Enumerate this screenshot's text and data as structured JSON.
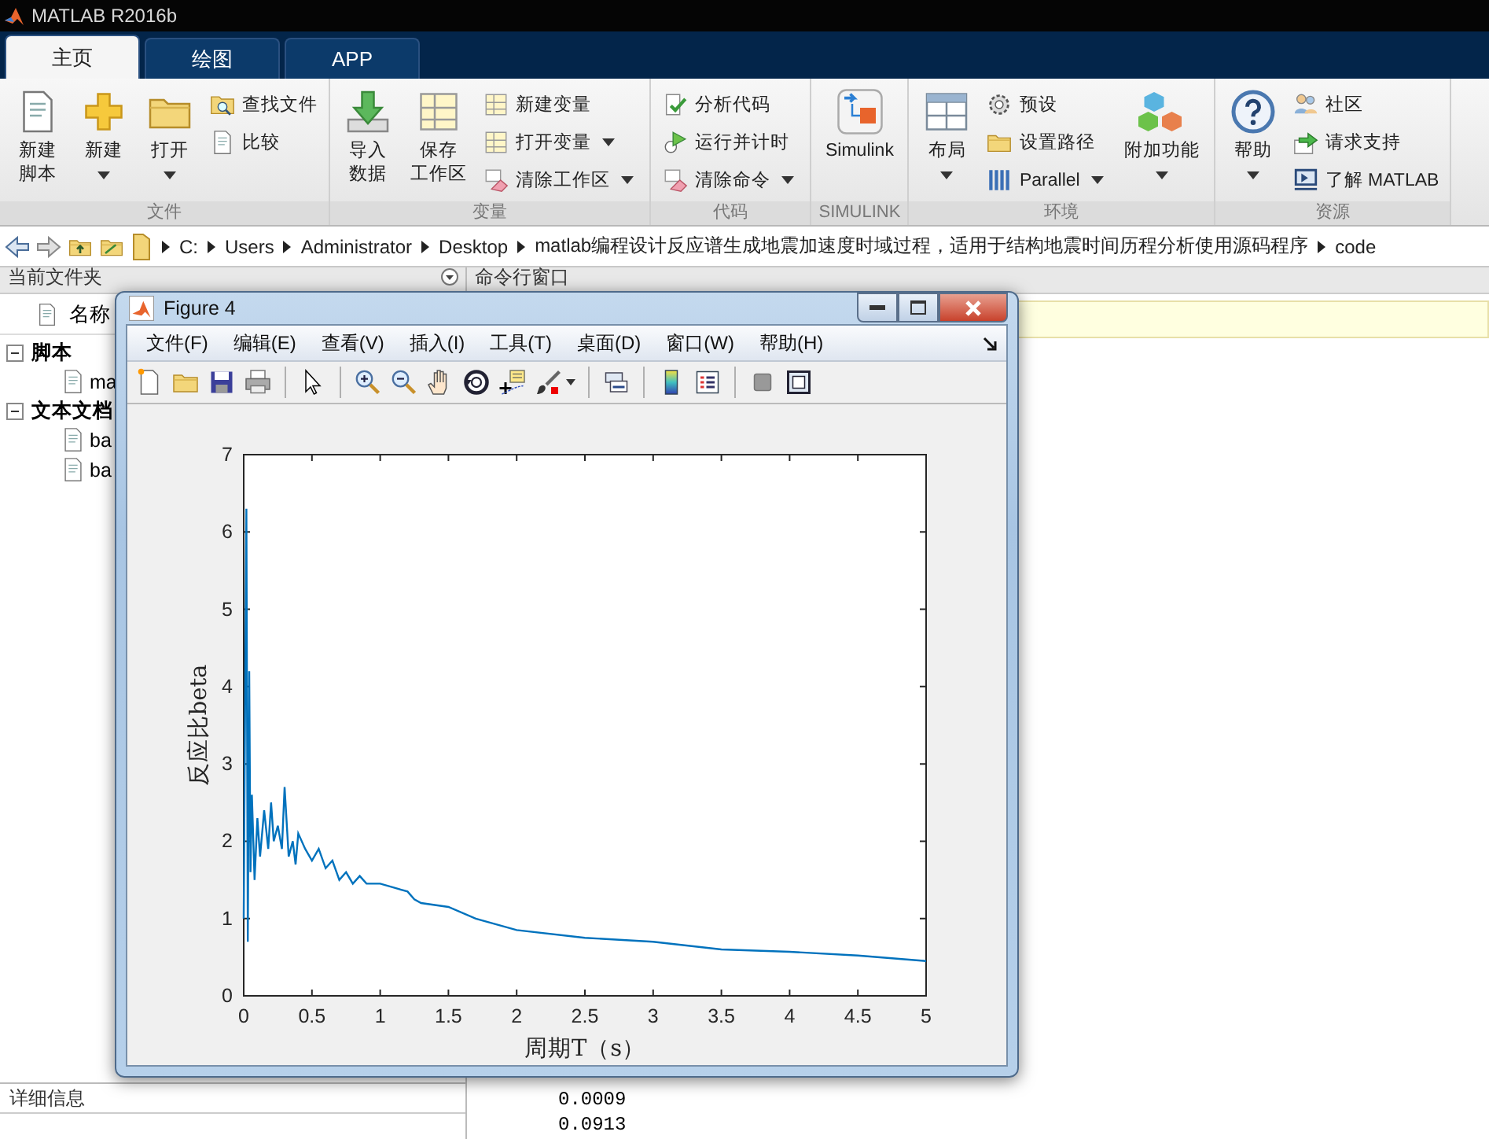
{
  "window": {
    "title": "MATLAB R2016b"
  },
  "tabs": [
    {
      "label": "主页",
      "selected": true
    },
    {
      "label": "绘图",
      "selected": false
    },
    {
      "label": "APP",
      "selected": false
    }
  ],
  "ribbon": {
    "groups": [
      {
        "label": "文件",
        "items": [
          {
            "kind": "large",
            "lines": [
              "新建",
              "脚本"
            ],
            "dropdown": false
          },
          {
            "kind": "large",
            "lines": [
              "新建"
            ],
            "dropdown": true
          },
          {
            "kind": "large",
            "lines": [
              "打开"
            ],
            "dropdown": true
          },
          {
            "kind": "stack",
            "items": [
              {
                "label": "查找文件",
                "dropdown": false
              },
              {
                "label": "比较",
                "dropdown": false
              }
            ]
          }
        ]
      },
      {
        "label": "变量",
        "items": [
          {
            "kind": "large",
            "lines": [
              "导入",
              "数据"
            ],
            "dropdown": false
          },
          {
            "kind": "large",
            "lines": [
              "保存",
              "工作区"
            ],
            "dropdown": false
          },
          {
            "kind": "stack",
            "items": [
              {
                "label": "新建变量",
                "dropdown": false
              },
              {
                "label": "打开变量",
                "dropdown": true
              },
              {
                "label": "清除工作区",
                "dropdown": true
              }
            ]
          }
        ]
      },
      {
        "label": "代码",
        "items": [
          {
            "kind": "stack",
            "items": [
              {
                "label": "分析代码",
                "dropdown": false
              },
              {
                "label": "运行并计时",
                "dropdown": false
              },
              {
                "label": "清除命令",
                "dropdown": true
              }
            ]
          }
        ]
      },
      {
        "label": "SIMULINK",
        "items": [
          {
            "kind": "large",
            "lines": [
              "Simulink"
            ],
            "dropdown": false
          }
        ]
      },
      {
        "label": "环境",
        "items": [
          {
            "kind": "large",
            "lines": [
              "布局"
            ],
            "dropdown": true
          },
          {
            "kind": "stack",
            "items": [
              {
                "label": "预设",
                "dropdown": false
              },
              {
                "label": "设置路径",
                "dropdown": false
              },
              {
                "label": "Parallel",
                "dropdown": true
              }
            ]
          },
          {
            "kind": "large",
            "lines": [
              "附加功能"
            ],
            "dropdown": true
          }
        ]
      },
      {
        "label": "资源",
        "items": [
          {
            "kind": "large",
            "lines": [
              "帮助"
            ],
            "dropdown": true
          },
          {
            "kind": "stack",
            "items": [
              {
                "label": "社区",
                "dropdown": false
              },
              {
                "label": "请求支持",
                "dropdown": false
              },
              {
                "label": "了解 MATLAB",
                "dropdown": false
              }
            ]
          }
        ]
      }
    ]
  },
  "address": {
    "path": [
      "C:",
      "Users",
      "Administrator",
      "Desktop",
      "matlab编程设计反应谱生成地震加速度时域过程，适用于结构地震时间历程分析使用源码程序",
      "code"
    ]
  },
  "current_folder": {
    "title": "当前文件夹",
    "column": "名称",
    "groups": [
      {
        "label": "脚本",
        "expanded": true,
        "children": [
          {
            "label": "ma"
          }
        ]
      },
      {
        "label": "文本文档",
        "expanded": true,
        "children": [
          {
            "label": "ba"
          },
          {
            "label": "ba"
          }
        ]
      }
    ]
  },
  "details": {
    "title": "详细信息"
  },
  "command_window": {
    "title": "命令行窗口",
    "output": [
      "0.0009",
      "0.0913"
    ]
  },
  "figure": {
    "title": "Figure 4",
    "menu": [
      "文件(F)",
      "编辑(E)",
      "查看(V)",
      "插入(I)",
      "工具(T)",
      "桌面(D)",
      "窗口(W)",
      "帮助(H)"
    ],
    "chart_data": {
      "type": "line",
      "xlabel": "周期T（s）",
      "ylabel": "反应比beta",
      "xlim": [
        0,
        5
      ],
      "ylim": [
        0,
        7
      ],
      "xticks": [
        0,
        0.5,
        1,
        1.5,
        2,
        2.5,
        3,
        3.5,
        4,
        4.5,
        5
      ],
      "yticks": [
        0,
        1,
        2,
        3,
        4,
        5,
        6,
        7
      ],
      "x": [
        0,
        0.02,
        0.03,
        0.04,
        0.05,
        0.06,
        0.08,
        0.1,
        0.12,
        0.15,
        0.18,
        0.2,
        0.22,
        0.25,
        0.28,
        0.3,
        0.33,
        0.36,
        0.38,
        0.4,
        0.45,
        0.5,
        0.55,
        0.6,
        0.65,
        0.7,
        0.75,
        0.8,
        0.85,
        0.9,
        1.0,
        1.1,
        1.2,
        1.25,
        1.3,
        1.5,
        1.7,
        2.0,
        2.5,
        3.0,
        3.5,
        4.0,
        4.5,
        5.0
      ],
      "series": [
        {
          "color": "#0072bd",
          "values": [
            1.0,
            6.3,
            0.7,
            4.2,
            1.6,
            2.6,
            1.5,
            2.3,
            1.8,
            2.4,
            1.9,
            2.5,
            2.0,
            2.2,
            1.9,
            2.7,
            1.8,
            2.0,
            1.7,
            2.1,
            1.9,
            1.75,
            1.9,
            1.65,
            1.75,
            1.5,
            1.6,
            1.45,
            1.55,
            1.45,
            1.45,
            1.4,
            1.35,
            1.25,
            1.2,
            1.15,
            1.0,
            0.85,
            0.75,
            0.7,
            0.6,
            0.57,
            0.52,
            0.45
          ]
        }
      ]
    }
  }
}
